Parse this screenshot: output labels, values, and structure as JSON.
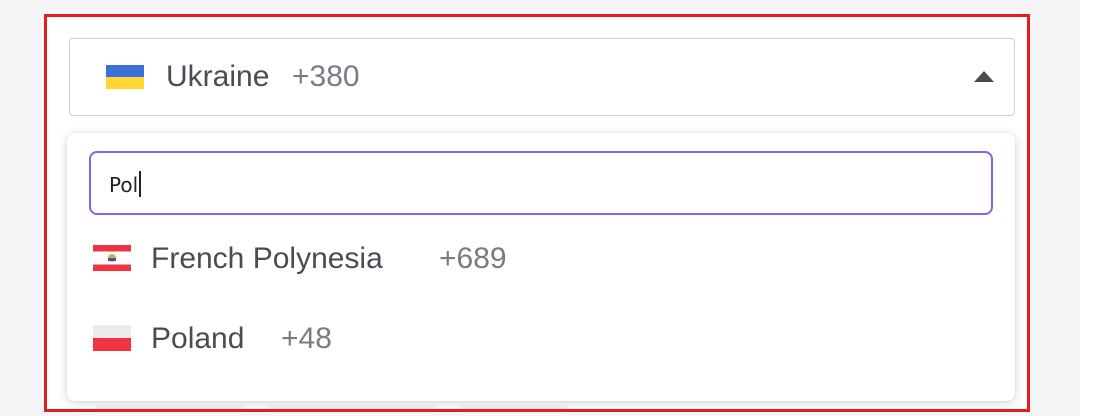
{
  "phone_field": {
    "selected_country": {
      "name": "Ukraine",
      "dial_code": "+380",
      "flag_icon": "ukraine-flag-icon",
      "flag_colors": [
        "#3b6fdc",
        "#ffd633"
      ]
    },
    "expanded": true
  },
  "dropdown": {
    "search_value": "Pol",
    "options": [
      {
        "name": "French Polynesia",
        "dial_code": "+689",
        "flag_icon": "french-polynesia-flag-icon",
        "flag_colors": [
          "#ef3340",
          "#ffffff"
        ]
      },
      {
        "name": "Poland",
        "dial_code": "+48",
        "flag_icon": "poland-flag-icon",
        "flag_colors": [
          "#ececef",
          "#ef3340"
        ]
      }
    ]
  },
  "colors": {
    "highlight_border": "#e11d1d",
    "search_focus_border": "#8c62e0",
    "select_border": "#cfcfd4",
    "country_text": "#4b4b55",
    "dial_code_text": "#7b7b85"
  }
}
